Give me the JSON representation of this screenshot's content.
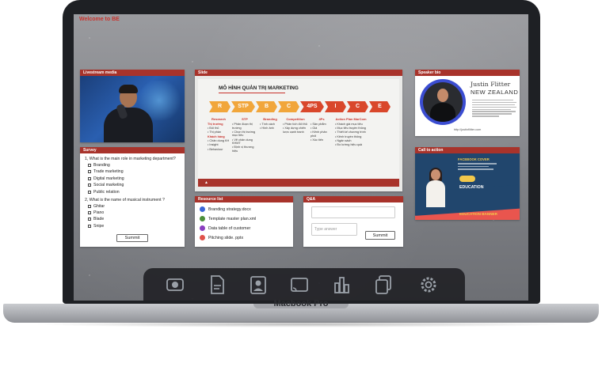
{
  "screen_title": "Welcome to BE",
  "device_label": "Macbook Pro",
  "livestream": {
    "title": "Livestream media"
  },
  "survey": {
    "title": "Survey",
    "q1": "1, What is the main role in marketing department?",
    "q1_options": [
      "Branding",
      "Trade marketing",
      "Digital marketing",
      "Social marketing",
      "Public relation"
    ],
    "q2": "2, What is the name of musical instrument ?",
    "q2_options": [
      "Ghitar",
      "Piano",
      "Blade",
      "Snipe"
    ],
    "submit": "Summit"
  },
  "slide": {
    "title": "Slide",
    "heading": "MÔ HÌNH QUẢN TRỊ MARKETING",
    "steps": [
      "R",
      "STP",
      "B",
      "C",
      "4PS",
      "I",
      "C",
      "E"
    ],
    "columns": [
      {
        "head": "Research",
        "items": [
          "Thị trường",
          "• Đối thủ",
          "• Thị phần",
          "Khách hàng",
          "• Chân dung KH",
          "• Insight",
          "• Behaviour"
        ]
      },
      {
        "head": "STP",
        "items": [
          "• Phân đoạn thị trường",
          "• Chọn thị trường mục tiêu",
          "• Vẽ chân dung KHMT",
          "• Định vị thương hiệu"
        ]
      },
      {
        "head": "Branding",
        "items": [
          "• Tính cách",
          "• Hình ảnh"
        ]
      },
      {
        "head": "Competition",
        "items": [
          "• Phân tích đối thủ",
          "• Xây dựng chiến lược cạnh tranh"
        ]
      },
      {
        "head": "4Ps",
        "items": [
          "• Sản phẩm",
          "• Giá",
          "• Kênh phân phối",
          "• Xúc tiến"
        ]
      },
      {
        "head": "Action Plan MarCom",
        "items": [
          "• Khách giá mục tiêu",
          "• Mục tiêu truyền thông",
          "• Thiết kế chương trình",
          "• Kênh truyền thông",
          "• Ngân sách",
          "• Đo lường hiệu quả"
        ]
      }
    ],
    "caret": "▲"
  },
  "resources": {
    "title": "Resource list",
    "items": [
      {
        "name": "Branding strategy.docx",
        "color": "#3b66d6"
      },
      {
        "name": "Template master plan.xml",
        "color": "#4b8e3a"
      },
      {
        "name": "Data table of customer",
        "color": "#8a3fbf"
      },
      {
        "name": "Pitching slide. pptx",
        "color": "#e0524a"
      }
    ]
  },
  "qa": {
    "title": "Q&A",
    "placeholder": "Type answer",
    "submit": "Summit"
  },
  "speaker": {
    "title": "Speaker bio",
    "name": "Justin Flitter",
    "country": "NEW ZEALAND",
    "url": "http://justinflitter.com"
  },
  "cta": {
    "title": "Call to action",
    "line1": "FACEBOOK COVER",
    "line2": "EDUCATION",
    "line3": "EDUCATION BANNER"
  },
  "dock": {
    "icons": [
      "camera-icon",
      "document-icon",
      "contact-icon",
      "cast-icon",
      "bar-chart-icon",
      "copy-icon",
      "settings-icon"
    ]
  }
}
